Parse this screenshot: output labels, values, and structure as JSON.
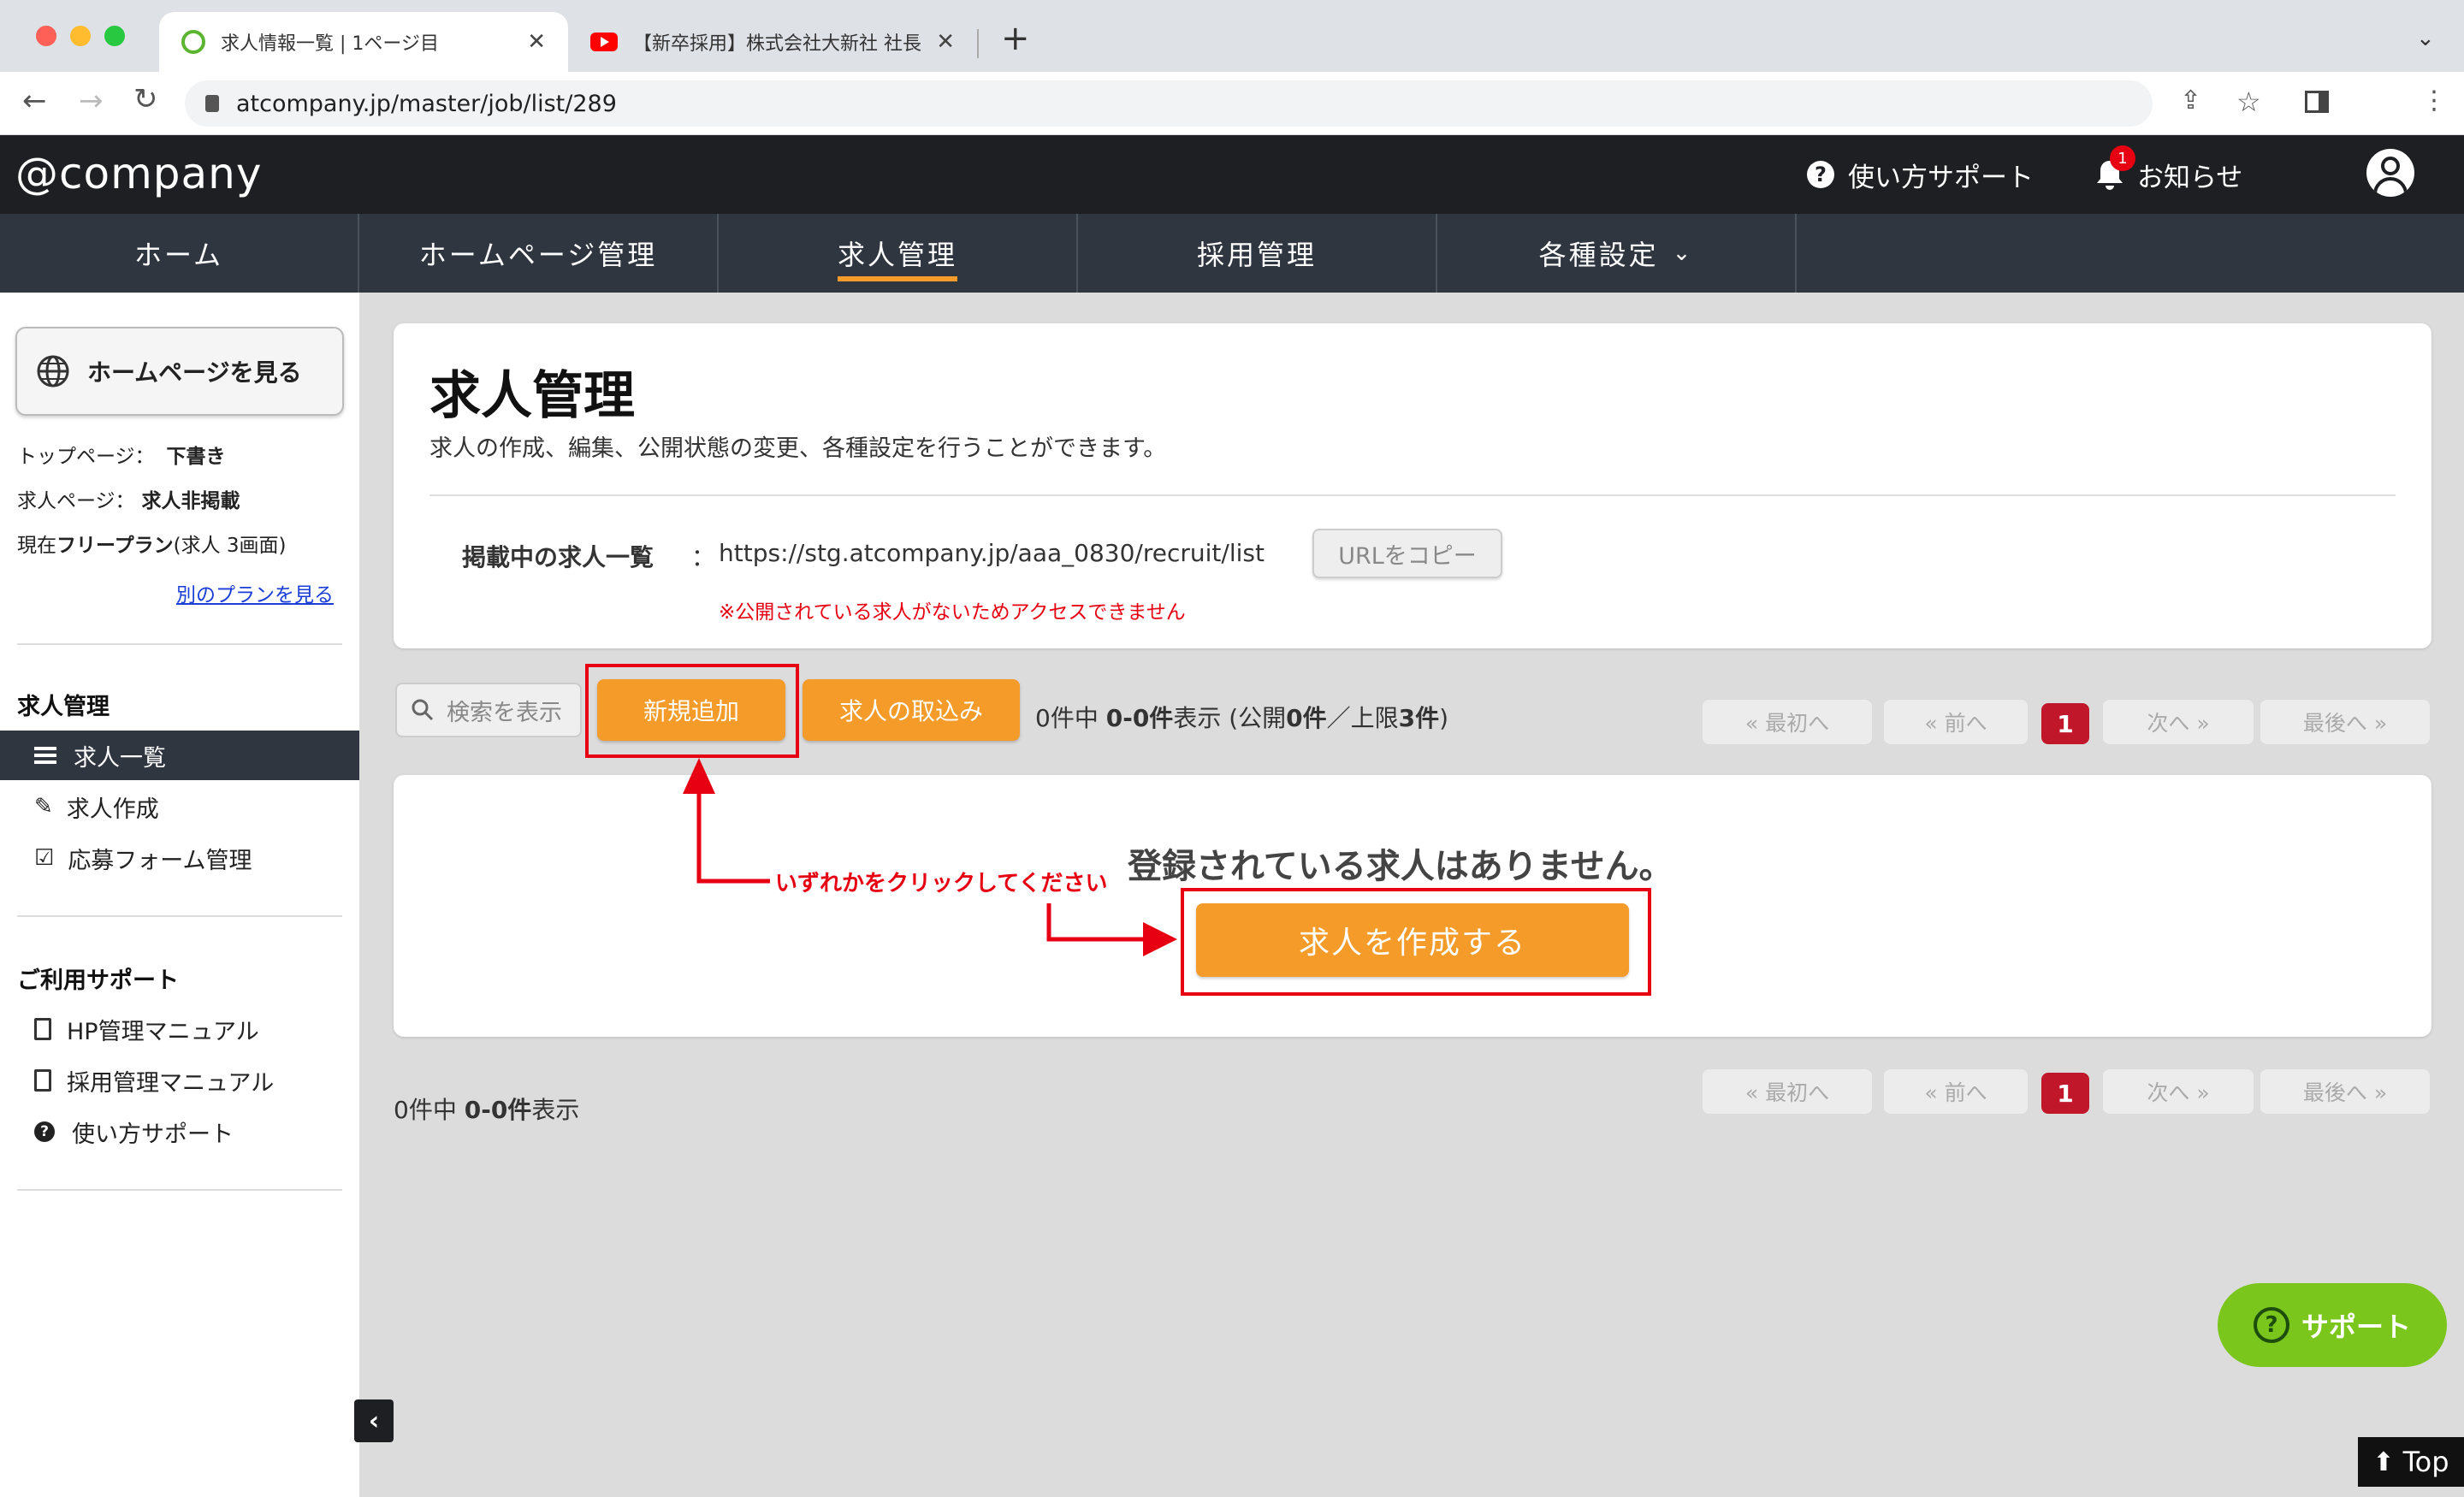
{
  "browser": {
    "tabs": [
      {
        "title": "求人情報一覧 | 1ページ目"
      },
      {
        "title": "【新卒採用】株式会社大新社 社長"
      }
    ],
    "url": "atcompany.jp/master/job/list/289"
  },
  "header": {
    "logo": "@company",
    "help": "使い方サポート",
    "notice": "お知らせ",
    "notice_badge": "1"
  },
  "nav": {
    "items": [
      "ホーム",
      "ホームページ管理",
      "求人管理",
      "採用管理",
      "各種設定"
    ],
    "active": "求人管理"
  },
  "sidebar": {
    "view_hp": "ホームページを見る",
    "top_page_label": "トップページ：",
    "top_page_value": "下書き",
    "job_page_label": "求人ページ：",
    "job_page_value": "求人非掲載",
    "plan_prefix": "現在",
    "plan_name": "フリープラン",
    "plan_suffix": "(求人 3画面)",
    "other_plan": "別のプランを見る",
    "section_job": "求人管理",
    "job_links": [
      "求人一覧",
      "求人作成",
      "応募フォーム管理"
    ],
    "section_support": "ご利用サポート",
    "support_links": [
      "HP管理マニュアル",
      "採用管理マニュアル",
      "使い方サポート"
    ]
  },
  "main": {
    "title": "求人管理",
    "description": "求人の作成、編集、公開状態の変更、各種設定を行うことができます。",
    "listing_label": "掲載中の求人一覧",
    "listing_sep": "：",
    "listing_url": "https://stg.atcompany.jp/aaa_0830/recruit/list",
    "copy_button": "URLをコピー",
    "warning": "※公開されている求人がないためアクセスできません",
    "search_button": "検索を表示",
    "add_button": "新規追加",
    "import_button": "求人の取込み",
    "count_text": {
      "p1": "0件中 ",
      "b1": "0-0件",
      "p2": "表示 (公開",
      "b2": "0件",
      "p3": "／上限",
      "b3": "3件",
      "p4": ")"
    },
    "pagination": {
      "first": "« 最初へ",
      "prev": "« 前へ",
      "current": "1",
      "next": "次へ »",
      "last": "最後へ »"
    },
    "empty_message": "登録されている求人はありません。",
    "create_button": "求人を作成する",
    "annotation": "いずれかをクリックしてください",
    "bottom_count": {
      "p1": "0件中 ",
      "b1": "0-0件",
      "p2": "表示"
    }
  },
  "support_button": "サポート",
  "top_button": "Top",
  "colors": {
    "orange": "#f49b29",
    "accent_underline": "#f49b29",
    "nav_bg": "#2f3640",
    "header_bg": "#1d1f22",
    "red": "#e60012",
    "support_green": "#7ac61c",
    "page_active": "#c0172a"
  }
}
